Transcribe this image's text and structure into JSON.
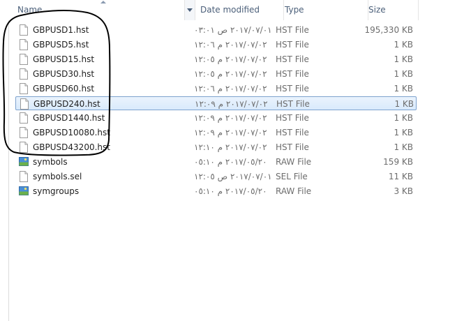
{
  "header": {
    "name_label": "Name",
    "date_label": "Date modified",
    "type_label": "Type",
    "size_label": "Size"
  },
  "files": [
    {
      "name": "GBPUSD1.hst",
      "date": "٢٠١٧/٠٧/٠١ ص ٠٣:٠١",
      "type": "HST File",
      "size": "195,330 KB",
      "icon": "file-icon"
    },
    {
      "name": "GBPUSD5.hst",
      "date": "٢٠١٧/٠٧/٠٢ م ١٢:٠٦",
      "type": "HST File",
      "size": "1 KB",
      "icon": "file-icon"
    },
    {
      "name": "GBPUSD15.hst",
      "date": "٢٠١٧/٠٧/٠٢ م ١٢:٠٥",
      "type": "HST File",
      "size": "1 KB",
      "icon": "file-icon"
    },
    {
      "name": "GBPUSD30.hst",
      "date": "٢٠١٧/٠٧/٠٢ م ١٢:٠٥",
      "type": "HST File",
      "size": "1 KB",
      "icon": "file-icon"
    },
    {
      "name": "GBPUSD60.hst",
      "date": "٢٠١٧/٠٧/٠٢ م ١٢:٠٦",
      "type": "HST File",
      "size": "1 KB",
      "icon": "file-icon"
    },
    {
      "name": "GBPUSD240.hst",
      "date": "٢٠١٧/٠٧/٠٢ م ١٢:٠٩",
      "type": "HST File",
      "size": "1 KB",
      "icon": "file-icon",
      "selected": true
    },
    {
      "name": "GBPUSD1440.hst",
      "date": "٢٠١٧/٠٧/٠٢ م ١٢:٠٩",
      "type": "HST File",
      "size": "1 KB",
      "icon": "file-icon"
    },
    {
      "name": "GBPUSD10080.hst",
      "date": "٢٠١٧/٠٧/٠٢ م ١٢:٠٩",
      "type": "HST File",
      "size": "1 KB",
      "icon": "file-icon"
    },
    {
      "name": "GBPUSD43200.hst",
      "date": "٢٠١٧/٠٧/٠٢ م ١٢:١٠",
      "type": "HST File",
      "size": "1 KB",
      "icon": "file-icon"
    },
    {
      "name": "symbols",
      "date": "٢٠١٧/٠٥/٢٠ م ٠٥:١٠",
      "type": "RAW File",
      "size": "159 KB",
      "icon": "image-file-icon"
    },
    {
      "name": "symbols.sel",
      "date": "٢٠١٧/٠٧/٠١ ص ١٢:٠٥",
      "type": "SEL File",
      "size": "11 KB",
      "icon": "file-icon"
    },
    {
      "name": "symgroups",
      "date": "٢٠١٧/٠٥/٢٠ م ٠٥:١٠",
      "type": "RAW File",
      "size": "3 KB",
      "icon": "image-file-icon"
    }
  ],
  "colors": {
    "header_text": "#4c607a",
    "selection_border": "#7da2ce",
    "annotation_ink": "#000000"
  }
}
